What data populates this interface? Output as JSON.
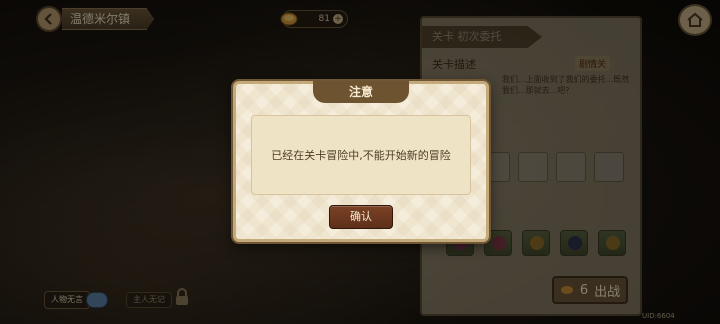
{
  "header": {
    "back_icon": "back-arrow-icon",
    "location_title": "温德米尔镇"
  },
  "currency": {
    "icon": "gold-coin-icon",
    "amount": "81",
    "plus_icon": "plus-icon"
  },
  "home": {
    "icon": "home-icon"
  },
  "stage_panel": {
    "header_title": "关卡 初次委托",
    "description_label": "关卡描述",
    "tag": "剧情关",
    "description_text": "我们...上面收到了我们的委托...既然我们...那就去...吧?"
  },
  "bottom_left": {
    "skip_story_label": "人物无言",
    "auto_label": "主人无记",
    "lock_icon": "lock-icon"
  },
  "fight_button": {
    "cost": "6",
    "label": "出战",
    "icon": "stamina-icon"
  },
  "uid": "UID:6604",
  "modal": {
    "title": "注意",
    "message": "已经在关卡冒险中,不能开始新的冒险",
    "confirm_label": "确认"
  }
}
